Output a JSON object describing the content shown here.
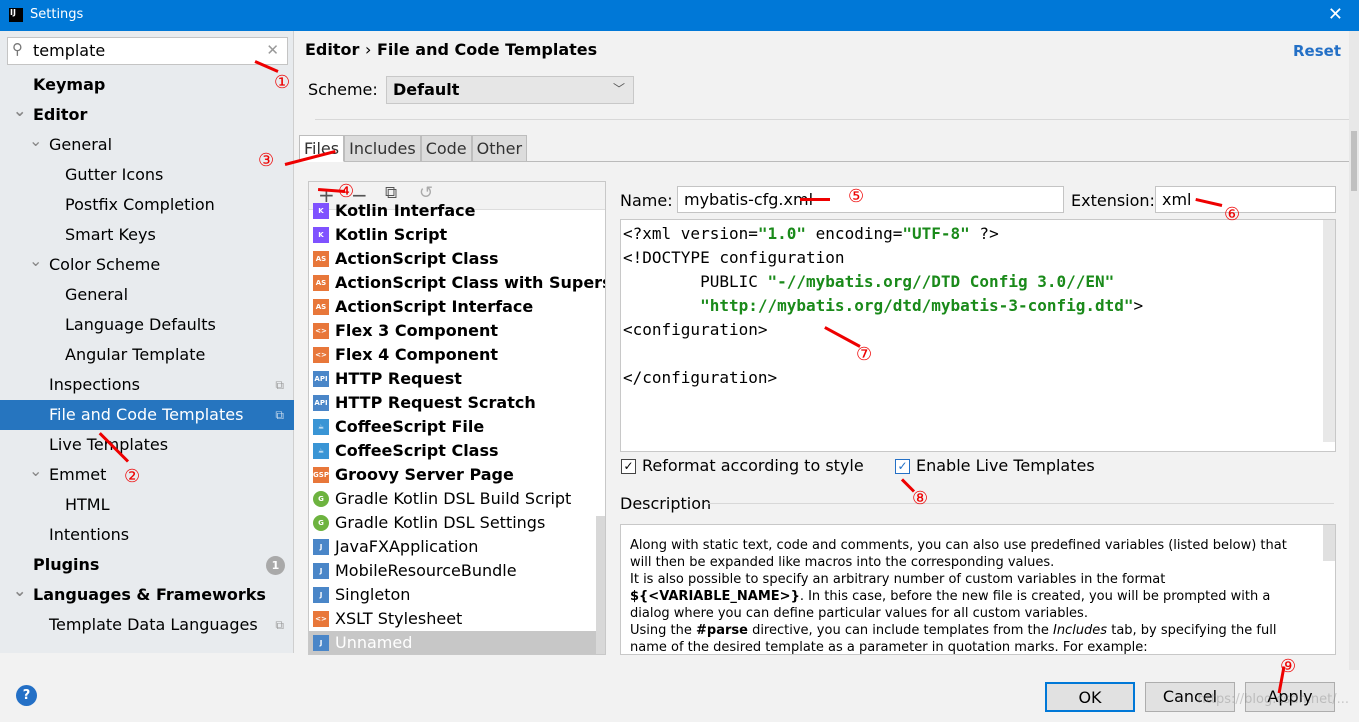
{
  "window": {
    "title": "Settings",
    "logo": "IJ",
    "close": "✕"
  },
  "search": {
    "value": "template",
    "icon": "search-icon",
    "clear": "✕"
  },
  "tree": [
    {
      "label": "Keymap",
      "level": 0,
      "bold": true
    },
    {
      "label": "Editor",
      "level": 0,
      "bold": true,
      "expanded": true
    },
    {
      "label": "General",
      "level": 1,
      "expanded": true
    },
    {
      "label": "Gutter Icons",
      "level": 2
    },
    {
      "label": "Postfix Completion",
      "level": 2
    },
    {
      "label": "Smart Keys",
      "level": 2
    },
    {
      "label": "Color Scheme",
      "level": 1,
      "expanded": true
    },
    {
      "label": "General",
      "level": 2
    },
    {
      "label": "Language Defaults",
      "level": 2
    },
    {
      "label": "Angular Template",
      "level": 2
    },
    {
      "label": "Inspections",
      "level": 1,
      "page": true
    },
    {
      "label": "File and Code Templates",
      "level": 1,
      "page": true,
      "selected": true
    },
    {
      "label": "Live Templates",
      "level": 1
    },
    {
      "label": "Emmet",
      "level": 1,
      "expanded": true
    },
    {
      "label": "HTML",
      "level": 2
    },
    {
      "label": "Intentions",
      "level": 1
    },
    {
      "label": "Plugins",
      "level": 0,
      "bold": true,
      "badge": "1"
    },
    {
      "label": "Languages & Frameworks",
      "level": 0,
      "bold": true,
      "expanded": true
    },
    {
      "label": "Template Data Languages",
      "level": 1,
      "page": true
    }
  ],
  "header": {
    "crumb1": "Editor",
    "sep": "›",
    "crumb2": "File and Code Templates",
    "reset": "Reset"
  },
  "scheme": {
    "label": "Scheme:",
    "value": "Default"
  },
  "tabs": [
    {
      "label": "Files",
      "active": true
    },
    {
      "label": "Includes"
    },
    {
      "label": "Code"
    },
    {
      "label": "Other"
    }
  ],
  "list_toolbar": {
    "add": "+",
    "remove": "−",
    "copy": "⧉",
    "reset": "↺"
  },
  "templates": [
    {
      "label": "Kotlin Interface",
      "bold": true,
      "icon": "K",
      "color": "#7f52ff"
    },
    {
      "label": "Kotlin Script",
      "bold": true,
      "icon": "K",
      "color": "#7f52ff"
    },
    {
      "label": "ActionScript Class",
      "bold": true,
      "icon": "AS",
      "color": "#e8773a"
    },
    {
      "label": "ActionScript Class with Supers",
      "bold": true,
      "icon": "AS",
      "color": "#e8773a"
    },
    {
      "label": "ActionScript Interface",
      "bold": true,
      "icon": "AS",
      "color": "#e8773a"
    },
    {
      "label": "Flex 3 Component",
      "bold": true,
      "icon": "<>",
      "color": "#e8773a"
    },
    {
      "label": "Flex 4 Component",
      "bold": true,
      "icon": "<>",
      "color": "#e8773a"
    },
    {
      "label": "HTTP Request",
      "bold": true,
      "icon": "API",
      "color": "#4a86c8"
    },
    {
      "label": "HTTP Request Scratch",
      "bold": true,
      "icon": "API",
      "color": "#4a86c8"
    },
    {
      "label": "CoffeeScript File",
      "bold": true,
      "icon": "☕",
      "color": "#3a95d5"
    },
    {
      "label": "CoffeeScript Class",
      "bold": true,
      "icon": "☕",
      "color": "#3a95d5"
    },
    {
      "label": "Groovy Server Page",
      "bold": true,
      "icon": "GSP",
      "color": "#e8773a"
    },
    {
      "label": "Gradle Kotlin DSL Build Script",
      "icon": "G",
      "color": "#6db33f"
    },
    {
      "label": "Gradle Kotlin DSL Settings",
      "icon": "G",
      "color": "#6db33f"
    },
    {
      "label": "JavaFXApplication",
      "icon": "J",
      "color": "#4a86c8"
    },
    {
      "label": "MobileResourceBundle",
      "icon": "J",
      "color": "#4a86c8"
    },
    {
      "label": "Singleton",
      "icon": "J",
      "color": "#4a86c8"
    },
    {
      "label": "XSLT Stylesheet",
      "icon": "<>",
      "color": "#e8773a"
    },
    {
      "label": "Unnamed",
      "icon": "J",
      "color": "#4a86c8",
      "selected": true
    }
  ],
  "editor": {
    "name_label": "Name:",
    "name_value": "mybatis-cfg.xml",
    "ext_label": "Extension:",
    "ext_value": "xml",
    "code": {
      "l1a": "<?xml version=",
      "l1b": "\"1.0\"",
      "l1c": " encoding=",
      "l1d": "\"UTF-8\"",
      "l1e": " ?>",
      "l2": "<!DOCTYPE configuration",
      "l3a": "        PUBLIC ",
      "l3b": "\"-//mybatis.org//DTD Config 3.0//EN\"",
      "l4a": "        ",
      "l4b": "\"http://mybatis.org/dtd/mybatis-3-config.dtd\"",
      "l4c": ">",
      "l5": "<configuration>",
      "l6": "",
      "l7": "</configuration>"
    },
    "reformat": {
      "label": "Reformat according to style",
      "checked": true
    },
    "live": {
      "label": "Enable Live Templates",
      "checked": true
    }
  },
  "description": {
    "title": "Description",
    "p1": "Along with static text, code and comments, you can also use predefined variables (listed below) that will then be expanded like macros into the corresponding values.",
    "p2a": "It is also possible to specify an arbitrary number of custom variables in the format ",
    "p2b": "${<VARIABLE_NAME>}",
    "p2c": ". In this case, before the new file is created, you will be prompted with a dialog where you can define particular values for all custom variables.",
    "p3a": "Using the ",
    "p3b": "#parse",
    "p3c": " directive, you can include templates from the ",
    "p3d": "Includes",
    "p3e": " tab, by specifying the full name of the desired template as a parameter in quotation marks. For example:"
  },
  "buttons": {
    "help": "?",
    "ok": "OK",
    "cancel": "Cancel",
    "apply": "Apply"
  },
  "watermark": "https://blog.csdn.net/...",
  "annotations": [
    "①",
    "②",
    "③",
    "④",
    "⑤",
    "⑥",
    "⑦",
    "⑧",
    "⑨"
  ],
  "colors": {
    "titlebar": "#0078d7",
    "selection": "#2675bf",
    "annotation": "#e00000",
    "string": "#1a8a1a"
  }
}
